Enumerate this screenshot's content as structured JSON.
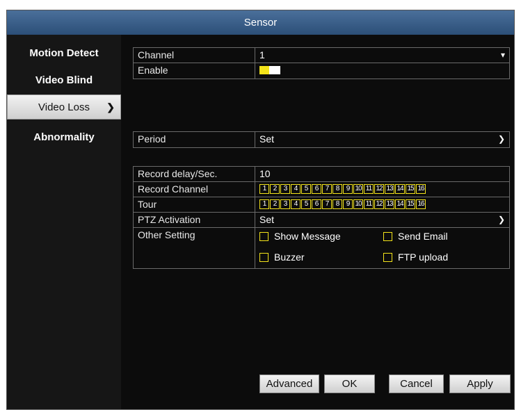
{
  "title": "Sensor",
  "sidebar": {
    "items": [
      {
        "label": "Motion Detect"
      },
      {
        "label": "Video Blind"
      },
      {
        "label": "Video Loss"
      },
      {
        "label": "Abnormality"
      }
    ],
    "active_index": 2
  },
  "settings": {
    "channel": {
      "label": "Channel",
      "value": "1"
    },
    "enable": {
      "label": "Enable",
      "on": true
    },
    "period": {
      "label": "Period",
      "value": "Set"
    },
    "record_delay": {
      "label": "Record delay/Sec.",
      "value": "10"
    },
    "record_channel": {
      "label": "Record Channel"
    },
    "tour": {
      "label": "Tour"
    },
    "ptz": {
      "label": "PTZ Activation",
      "value": "Set"
    },
    "other": {
      "label": "Other Setting",
      "options": {
        "show_message": "Show Message",
        "send_email": "Send Email",
        "buzzer": "Buzzer",
        "ftp_upload": "FTP upload"
      }
    }
  },
  "channels": [
    "1",
    "2",
    "3",
    "4",
    "5",
    "6",
    "7",
    "8",
    "9",
    "10",
    "11",
    "12",
    "13",
    "14",
    "15",
    "16"
  ],
  "buttons": {
    "advanced": "Advanced",
    "ok": "OK",
    "cancel": "Cancel",
    "apply": "Apply"
  },
  "colors": {
    "accent": "#f4e41a",
    "titlebar": "#3b5f8a"
  }
}
